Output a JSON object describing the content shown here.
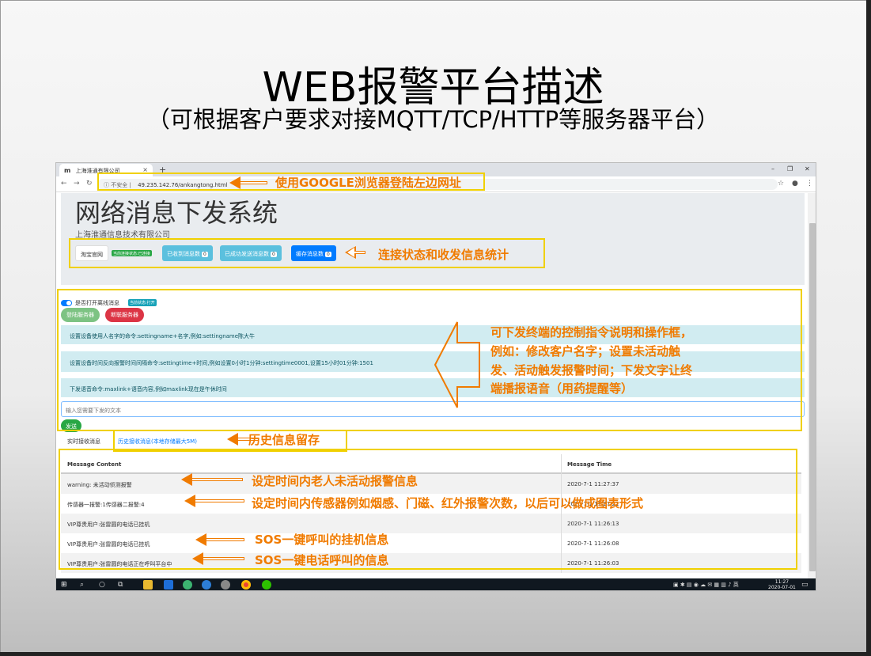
{
  "slide": {
    "title": "WEB报警平台描述",
    "subtitle": "（可根据客户要求对接MQTT/TCP/HTTP等服务器平台）"
  },
  "browser": {
    "tab_favicon": "m",
    "tab_title": "上海淮通有限公司",
    "tab_close": "×",
    "new_tab": "+",
    "insecure_label": "不安全",
    "url": "49.235.142.76/ankangtong.html",
    "win_min": "–",
    "win_max": "❐",
    "win_close": "✕"
  },
  "page": {
    "system_title": "网络消息下发系统",
    "company": "上海淮通信息技术有限公司",
    "btn_taobao": "淘宝官网",
    "conn_status": "当前连接状态:已连接",
    "received_label": "已收到消息数",
    "received_count": "0",
    "sent_label": "已成功发送消息数",
    "sent_count": "0",
    "cached_label": "缓存消息数",
    "cached_count": "0",
    "offline_toggle_label": "是否打开离线消息",
    "offline_status": "当前状态:打开",
    "btn_connect": "登陆服务器",
    "btn_disconnect": "断联服务器",
    "commands": [
      "设置设备使用人名字的命令:settingname+名字,例如:settingname陈大牛",
      "设置设备时间反向报警时间间隔命令:settingtime+时间,例如设置0小时1分钟:settingtime0001,设置15小时01分钟:1501",
      "下发语音命令:maxlink+语音内容,例如maxlink现在是午休时间"
    ],
    "input_placeholder": "输入您需要下发的文本",
    "btn_send": "发送",
    "tab_realtime": "实时接收消息",
    "tab_history": "历史接收消息(本地存储最大5M)"
  },
  "table": {
    "headers": [
      "Message Content",
      "Message Time"
    ],
    "rows": [
      [
        "warning: 未活动侦测报警",
        "2020-7-1 11:27:37"
      ],
      [
        "传感器一报警:1传感器二报警:4",
        "2020-7-1 11:27:21"
      ],
      [
        "VIP尊贵用户:张雷圆的电话已挂机",
        "2020-7-1 11:26:13"
      ],
      [
        "VIP尊贵用户:张雷圆的电话已挂机",
        "2020-7-1 11:26:08"
      ],
      [
        "VIP尊贵用户:张雷圆的电话正在呼叫平台中",
        "2020-7-1 11:26:03"
      ]
    ]
  },
  "taskbar": {
    "time": "11:27",
    "date": "2020-07-01"
  },
  "annotations": {
    "browser_login": "使用GOOGLE浏览器登陆左边网址",
    "status_stats": "连接状态和收发信息统计",
    "commands_desc_1": "可下发终端的控制指令说明和操作框，",
    "commands_desc_2": "例如：修改客户名字；设置未活动触",
    "commands_desc_3": "发、活动触发报警时间；下发文字让终",
    "commands_desc_4": "端播报语音（用药提醒等）",
    "history": "历史信息留存",
    "inactivity_alarm": "设定时间内老人未活动报警信息",
    "sensor_alarm": "设定时间内传感器例如烟感、门磁、红外报警次数，以后可以做成图表形式",
    "sos_hangup": "SOS一键呼叫的挂机信息",
    "sos_call": "SOS一键电话呼叫的信息"
  },
  "colors": {
    "annotation_text": "#f07b00",
    "highlight_box": "#f0d000",
    "info_button": "#5bc0de",
    "primary_button": "#007bff",
    "success": "#28a745",
    "danger": "#dc3545",
    "command_bg": "#d1ecf1"
  }
}
